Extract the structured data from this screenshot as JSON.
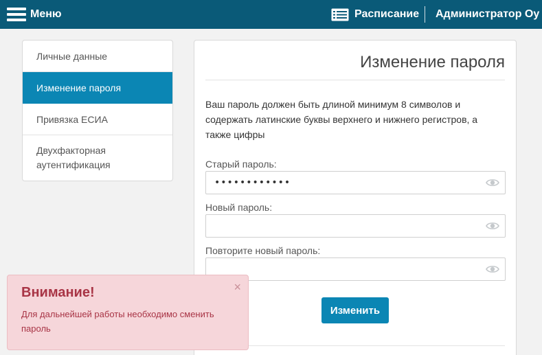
{
  "header": {
    "menu_label": "Меню",
    "schedule_label": "Расписание",
    "user_name": "Администратор Оу",
    "background": "#0a5a78"
  },
  "sidebar": {
    "items": [
      {
        "label": "Личные данные",
        "active": false
      },
      {
        "label": "Изменение пароля",
        "active": true
      },
      {
        "label": "Привязка ЕСИА",
        "active": false
      },
      {
        "label": "Двухфакторная аутентификация",
        "active": false
      }
    ],
    "active_color": "#0b86b4"
  },
  "main": {
    "title": "Изменение пароля",
    "info": "Ваш пароль должен быть длиной минимум 8 символов и содержать латинские буквы верхнего и нижнего регистров, а также цифры",
    "old_password": {
      "label": "Старый пароль:",
      "value": "••••••••••••",
      "icon": "eye-icon"
    },
    "new_password": {
      "label": "Новый пароль:",
      "value": "",
      "icon": "eye-icon"
    },
    "repeat_password": {
      "label": "Повторите новый пароль:",
      "value": "",
      "icon": "eye-icon"
    },
    "submit_label": "Изменить"
  },
  "alert": {
    "title": "Внимание!",
    "text": "Для дальнейшей работы необходимо сменить пароль",
    "close_glyph": "×",
    "color": "#a83445",
    "background": "#f6d6da"
  }
}
